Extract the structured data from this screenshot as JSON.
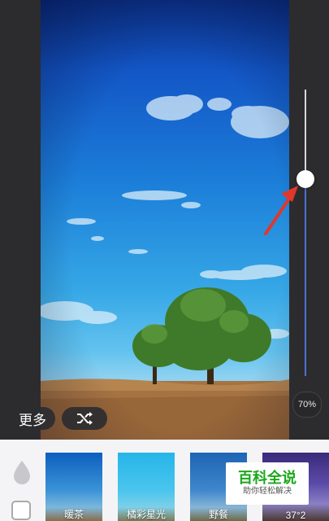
{
  "editor": {
    "intensity_value": 0.7,
    "intensity_label": "70%",
    "more_label": "更多",
    "shuffle_icon": "shuffle-icon",
    "accent_track_color": "#4d6fd1"
  },
  "toolbar": {
    "icons": [
      "drop-icon",
      "square-icon"
    ]
  },
  "filters": [
    {
      "label": "暖茶"
    },
    {
      "label": "橘彩星光"
    },
    {
      "label": "野餐"
    },
    {
      "label": "37°2"
    }
  ],
  "watermark": {
    "title": "百科全说",
    "subtitle": "助你轻松解决"
  }
}
